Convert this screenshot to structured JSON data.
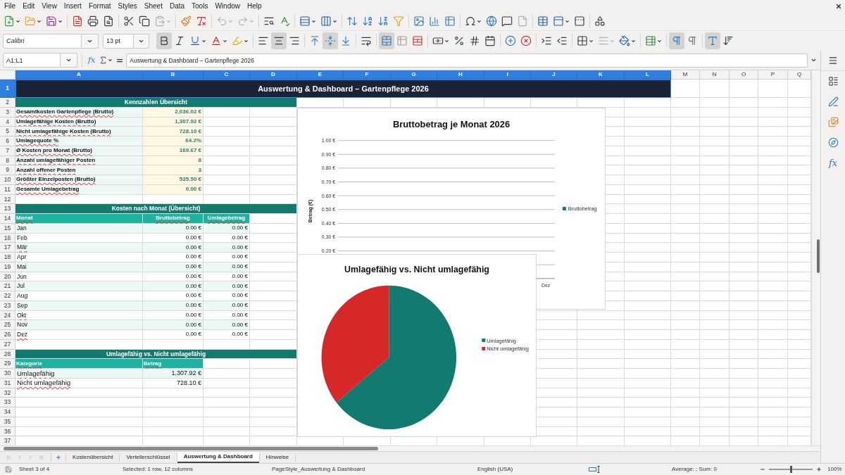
{
  "menu_bar": {
    "items": [
      "File",
      "Edit",
      "View",
      "Insert",
      "Format",
      "Styles",
      "Sheet",
      "Data",
      "Tools",
      "Window",
      "Help"
    ]
  },
  "standard_toolbar": {
    "buttons": [
      {
        "disabled": false
      },
      {
        "disabled": false
      },
      {
        "disabled": false
      },
      {
        "disabled": false
      },
      {
        "disabled": false
      },
      {
        "disabled": false
      },
      {
        "disabled": false
      },
      {
        "disabled": false
      },
      {
        "disabled": true
      },
      {
        "disabled": false
      },
      {
        "disabled": false
      },
      {
        "disabled": true
      },
      {
        "disabled": true
      },
      {
        "disabled": false
      },
      {
        "disabled": false
      },
      {
        "disabled": false
      },
      {
        "disabled": false
      },
      {
        "disabled": false
      },
      {
        "disabled": false
      },
      {
        "disabled": false
      },
      {
        "disabled": false
      },
      {
        "disabled": false
      },
      {
        "disabled": false
      },
      {
        "disabled": false
      },
      {
        "disabled": false
      },
      {
        "disabled": false
      },
      {
        "disabled": false
      },
      {
        "disabled": true
      },
      {
        "disabled": false
      },
      {
        "disabled": false
      },
      {
        "disabled": false
      },
      {
        "disabled": false
      }
    ]
  },
  "formatting_toolbar": {
    "font_name": "Calibri",
    "font_size": "13 pt",
    "buttons": [
      {
        "pressed": true,
        "disabled": false
      },
      {
        "pressed": false,
        "disabled": false
      },
      {
        "pressed": false,
        "disabled": false
      },
      {
        "pressed": false,
        "disabled": false
      },
      {
        "pressed": false,
        "disabled": false
      },
      {
        "pressed": false,
        "disabled": false
      },
      {
        "pressed": true,
        "disabled": false
      },
      {
        "pressed": false,
        "disabled": false
      },
      {
        "pressed": false,
        "disabled": false
      },
      {
        "pressed": true,
        "disabled": false
      },
      {
        "pressed": false,
        "disabled": false
      },
      {
        "pressed": false,
        "disabled": false
      },
      {
        "pressed": true,
        "disabled": false
      },
      {
        "pressed": false,
        "disabled": false
      },
      {
        "pressed": false,
        "disabled": false
      },
      {
        "pressed": false,
        "disabled": false
      },
      {
        "pressed": false,
        "disabled": false
      },
      {
        "pressed": false,
        "disabled": false
      },
      {
        "pressed": false,
        "disabled": false
      },
      {
        "pressed": false,
        "disabled": false
      },
      {
        "pressed": false,
        "disabled": false
      },
      {
        "pressed": false,
        "disabled": false
      },
      {
        "pressed": false,
        "disabled": false
      },
      {
        "pressed": false,
        "disabled": false
      },
      {
        "pressed": false,
        "disabled": true
      },
      {
        "pressed": false,
        "disabled": false
      },
      {
        "pressed": false,
        "disabled": false
      },
      {
        "pressed": true,
        "disabled": false
      },
      {
        "pressed": false,
        "disabled": false
      },
      {
        "pressed": true,
        "disabled": false
      },
      {
        "pressed": false,
        "disabled": false
      }
    ]
  },
  "formula_bar": {
    "name_box": "A1:L1",
    "function_wizard": "fx",
    "content": "Auswertung & Dashboard – Gartenpflege 2026"
  },
  "sheet": {
    "column_headers": [
      {
        "label": "A",
        "selected": true
      },
      {
        "label": "B",
        "selected": true
      },
      {
        "label": "C",
        "selected": true
      },
      {
        "label": "D",
        "selected": true
      },
      {
        "label": "E",
        "selected": true
      },
      {
        "label": "F",
        "selected": true
      },
      {
        "label": "G",
        "selected": true
      },
      {
        "label": "H",
        "selected": true
      },
      {
        "label": "I",
        "selected": true
      },
      {
        "label": "J",
        "selected": true
      },
      {
        "label": "K",
        "selected": true
      },
      {
        "label": "L",
        "selected": true
      },
      {
        "label": "M",
        "selected": false
      },
      {
        "label": "N",
        "selected": false
      },
      {
        "label": "O",
        "selected": false
      },
      {
        "label": "P",
        "selected": false
      },
      {
        "label": "Q",
        "selected": false
      }
    ],
    "row_headers": [
      {
        "label": "1",
        "selected": true
      },
      {
        "label": "2",
        "selected": false
      },
      {
        "label": "3",
        "selected": false
      },
      {
        "label": "4",
        "selected": false
      },
      {
        "label": "5",
        "selected": false
      },
      {
        "label": "6",
        "selected": false
      },
      {
        "label": "7",
        "selected": false
      },
      {
        "label": "8",
        "selected": false
      },
      {
        "label": "9",
        "selected": false
      },
      {
        "label": "10",
        "selected": false
      },
      {
        "label": "11",
        "selected": false
      },
      {
        "label": "12",
        "selected": false
      },
      {
        "label": "13",
        "selected": false
      },
      {
        "label": "14",
        "selected": false
      },
      {
        "label": "15",
        "selected": false
      },
      {
        "label": "16",
        "selected": false
      },
      {
        "label": "17",
        "selected": false
      },
      {
        "label": "18",
        "selected": false
      },
      {
        "label": "19",
        "selected": false
      },
      {
        "label": "20",
        "selected": false
      },
      {
        "label": "21",
        "selected": false
      },
      {
        "label": "22",
        "selected": false
      },
      {
        "label": "23",
        "selected": false
      },
      {
        "label": "24",
        "selected": false
      },
      {
        "label": "25",
        "selected": false
      },
      {
        "label": "26",
        "selected": false
      },
      {
        "label": "27",
        "selected": false
      },
      {
        "label": "28",
        "selected": false
      },
      {
        "label": "29",
        "selected": false
      },
      {
        "label": "30",
        "selected": false
      },
      {
        "label": "31",
        "selected": false
      },
      {
        "label": "32",
        "selected": false
      },
      {
        "label": "33",
        "selected": false
      },
      {
        "label": "34",
        "selected": false
      },
      {
        "label": "35",
        "selected": false
      },
      {
        "label": "36",
        "selected": false
      },
      {
        "label": "37",
        "selected": false
      }
    ],
    "title_cell": {
      "text": "Auswertung & Dashboard – Gartenpflege 2026",
      "selected": true
    },
    "kpi_section": {
      "heading": "Kennzahlen Übersicht",
      "rows": [
        {
          "label": "Gesamtkosten Gartenpflege (Brutto)",
          "value": "2,036.02 €",
          "misspelled": true
        },
        {
          "label": "Umlagefähige Kosten (Brutto)",
          "value": "1,307.92 €",
          "misspelled": true
        },
        {
          "label": "Nicht umlagefähige Kosten (Brutto)",
          "value": "728.10 €",
          "misspelled": true
        },
        {
          "label": "Umlagequote %",
          "value": "64.2%",
          "misspelled": true
        },
        {
          "label": "Ø Kosten pro Monat (Brutto)",
          "value": "169.67 €",
          "misspelled": true
        },
        {
          "label": "Anzahl umlagefähiger Posten",
          "value": "8",
          "misspelled": true
        },
        {
          "label": "Anzahl offener Posten",
          "value": "3",
          "misspelled": true
        },
        {
          "label": "Größter Einzelposten (Brutto)",
          "value": "535.50 €",
          "misspelled": true
        },
        {
          "label": "Gesamte Umlagebetrag",
          "value": "0.00 €",
          "misspelled": true
        }
      ]
    },
    "monthly_section": {
      "heading": "Kosten nach Monat (Übersicht)",
      "columns": [
        {
          "label": "Monat",
          "misspelled": true
        },
        {
          "label": "Bruttobetrag",
          "misspelled": true
        },
        {
          "label": "Umlagebetrag",
          "misspelled": true
        }
      ],
      "rows": [
        {
          "month": "Jan",
          "gross": "0.00 €",
          "allocation": "0.00 €",
          "misspelled": false
        },
        {
          "month": "Feb",
          "gross": "0.00 €",
          "allocation": "0.00 €",
          "misspelled": false
        },
        {
          "month": "Mär",
          "gross": "0.00 €",
          "allocation": "0.00 €",
          "misspelled": true
        },
        {
          "month": "Apr",
          "gross": "0.00 €",
          "allocation": "0.00 €",
          "misspelled": false
        },
        {
          "month": "Mai",
          "gross": "0.00 €",
          "allocation": "0.00 €",
          "misspelled": false
        },
        {
          "month": "Jun",
          "gross": "0.00 €",
          "allocation": "0.00 €",
          "misspelled": false
        },
        {
          "month": "Jul",
          "gross": "0.00 €",
          "allocation": "0.00 €",
          "misspelled": false
        },
        {
          "month": "Aug",
          "gross": "0.00 €",
          "allocation": "0.00 €",
          "misspelled": false
        },
        {
          "month": "Sep",
          "gross": "0.00 €",
          "allocation": "0.00 €",
          "misspelled": false
        },
        {
          "month": "Okt",
          "gross": "0.00 €",
          "allocation": "0.00 €",
          "misspelled": true
        },
        {
          "month": "Nov",
          "gross": "0.00 €",
          "allocation": "0.00 €",
          "misspelled": false
        },
        {
          "month": "Dez",
          "gross": "0.00 €",
          "allocation": "0.00 €",
          "misspelled": true
        }
      ]
    },
    "allocation_section": {
      "heading": "Umlagefähig vs. Nicht umlagefähig",
      "columns": [
        {
          "label": "Kategorie",
          "misspelled": true
        },
        {
          "label": "Betrag",
          "misspelled": true
        }
      ],
      "rows": [
        {
          "category": "Umlagefähig",
          "amount": "1,307.92 €",
          "misspelled": true
        },
        {
          "category": "Nicht umlagefähig",
          "amount": "728.10 €",
          "misspelled": true
        }
      ]
    },
    "charts": [
      {
        "chart_data": {
          "type": "bar",
          "title": "Bruttobetrag je Monat 2026",
          "ylabel": "Betrag (€)",
          "categories": [
            "Dez"
          ],
          "series": [
            {
              "name": "Bruttobetrag",
              "color": "#127a6e",
              "values": [
                0
              ]
            }
          ],
          "ylim": [
            0,
            1
          ],
          "yticks": [
            {
              "value": 0.2,
              "label": "0.20 €"
            },
            {
              "value": 0.3,
              "label": "0.30 €"
            },
            {
              "value": 0.4,
              "label": "0.40 €"
            },
            {
              "value": 0.5,
              "label": "0.50 €"
            },
            {
              "value": 0.6,
              "label": "0.60 €"
            },
            {
              "value": 0.7,
              "label": "0.70 €"
            },
            {
              "value": 0.8,
              "label": "0.80 €"
            },
            {
              "value": 0.9,
              "label": "0.90 €"
            },
            {
              "value": 1.0,
              "label": "1.00 €"
            }
          ],
          "grid": true,
          "legend": "right"
        }
      },
      {
        "chart_data": {
          "type": "pie",
          "title": "Umlagefähig vs. Nicht umlagefähig",
          "categories": [
            "Umlagefähig",
            "Nicht umlagefähig"
          ],
          "values": [
            64.2,
            35.8
          ],
          "colors": [
            "#127a6e",
            "#d62828"
          ],
          "legend": "right"
        }
      }
    ]
  },
  "sheet_navigation": [
    {
      "disabled": true
    },
    {
      "disabled": true
    },
    {
      "disabled": true
    },
    {
      "disabled": true
    }
  ],
  "sheet_tabs": [
    {
      "label": "Kostenübersicht",
      "selected": false
    },
    {
      "label": "Verteilerschlüssel",
      "selected": false
    },
    {
      "label": "Auswertung & Dashboard",
      "selected": true
    },
    {
      "label": "Hinweise",
      "selected": false
    }
  ],
  "sidebar": {
    "functions_label": "fx"
  },
  "status_bar": {
    "sheet": "Sheet 3 of 4",
    "selection": "Selected: 1 row, 12 columns",
    "page_style": "PageStyle_Auswertung & Dashboard",
    "language": "English (USA)",
    "summary": "Average: ; Sum: 0",
    "zoom": {
      "level": 0.5,
      "reading": "100%"
    }
  }
}
